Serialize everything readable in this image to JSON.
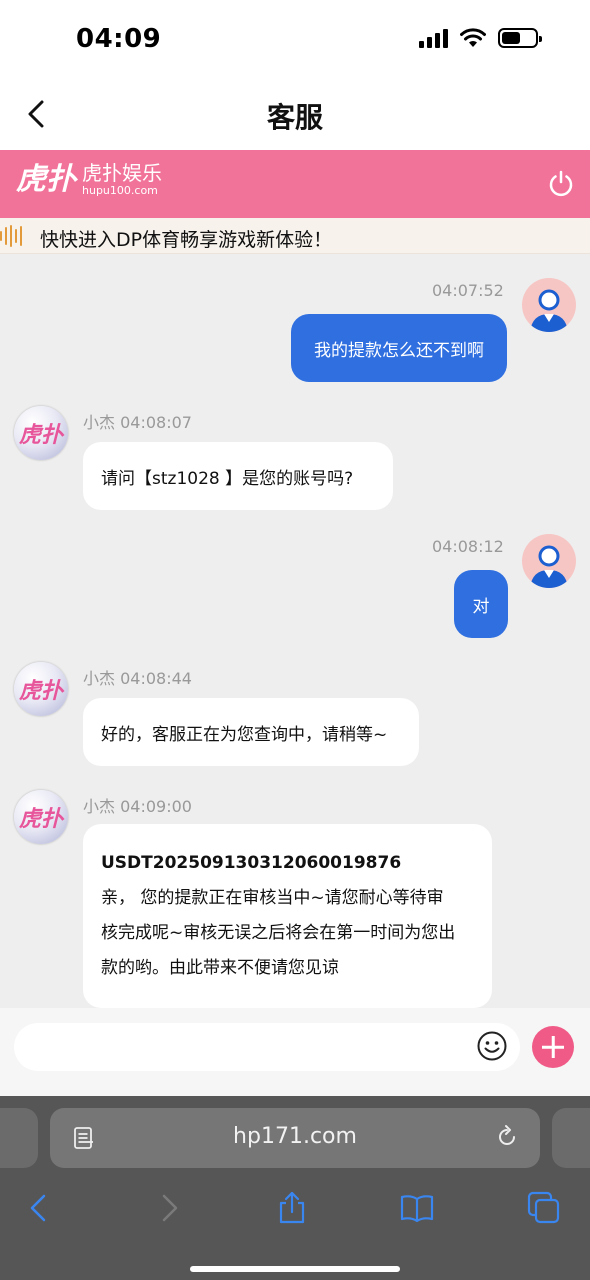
{
  "status_bar": {
    "time": "04:09"
  },
  "header": {
    "title": "客服"
  },
  "brand": {
    "mark": "虎扑",
    "name": "虎扑娱乐",
    "domain": "hupu100.com"
  },
  "marquee": {
    "text": "快快进入DP体育畅享游戏新体验！"
  },
  "agent": {
    "logo": "虎扑"
  },
  "messages": [
    {
      "from": "user",
      "time": "04:07:52",
      "text": "我的提款怎么还不到啊"
    },
    {
      "from": "agent",
      "sender": "小杰",
      "time": "04:08:07",
      "text": "请问【stz1028 】是您的账号吗?"
    },
    {
      "from": "user",
      "time": "04:08:12",
      "text": "对"
    },
    {
      "from": "agent",
      "sender": "小杰",
      "time": "04:08:44",
      "text": "好的，客服正在为您查询中，请稍等~"
    },
    {
      "from": "agent",
      "sender": "小杰",
      "time": "04:09:00",
      "lines": [
        "USDT2025091303120600198​76",
        "亲， 您的提款正在审核当中~请您耐心等待审",
        "核完成呢~审核无误之后将会在第一时间为您出",
        "款的哟。由此带来不便请您见谅"
      ]
    }
  ],
  "input": {
    "placeholder": ""
  },
  "browser": {
    "url": "hp171.com"
  },
  "colors": {
    "brand_pink": "#f2739a",
    "bubble_blue": "#2f6fe0",
    "plus_pink": "#f05a87"
  },
  "icons": [
    "back-chevron-icon",
    "power-icon",
    "emoji-icon",
    "plus-icon",
    "reader-icon",
    "reload-icon",
    "share-icon",
    "bookmarks-icon",
    "tabs-icon"
  ]
}
